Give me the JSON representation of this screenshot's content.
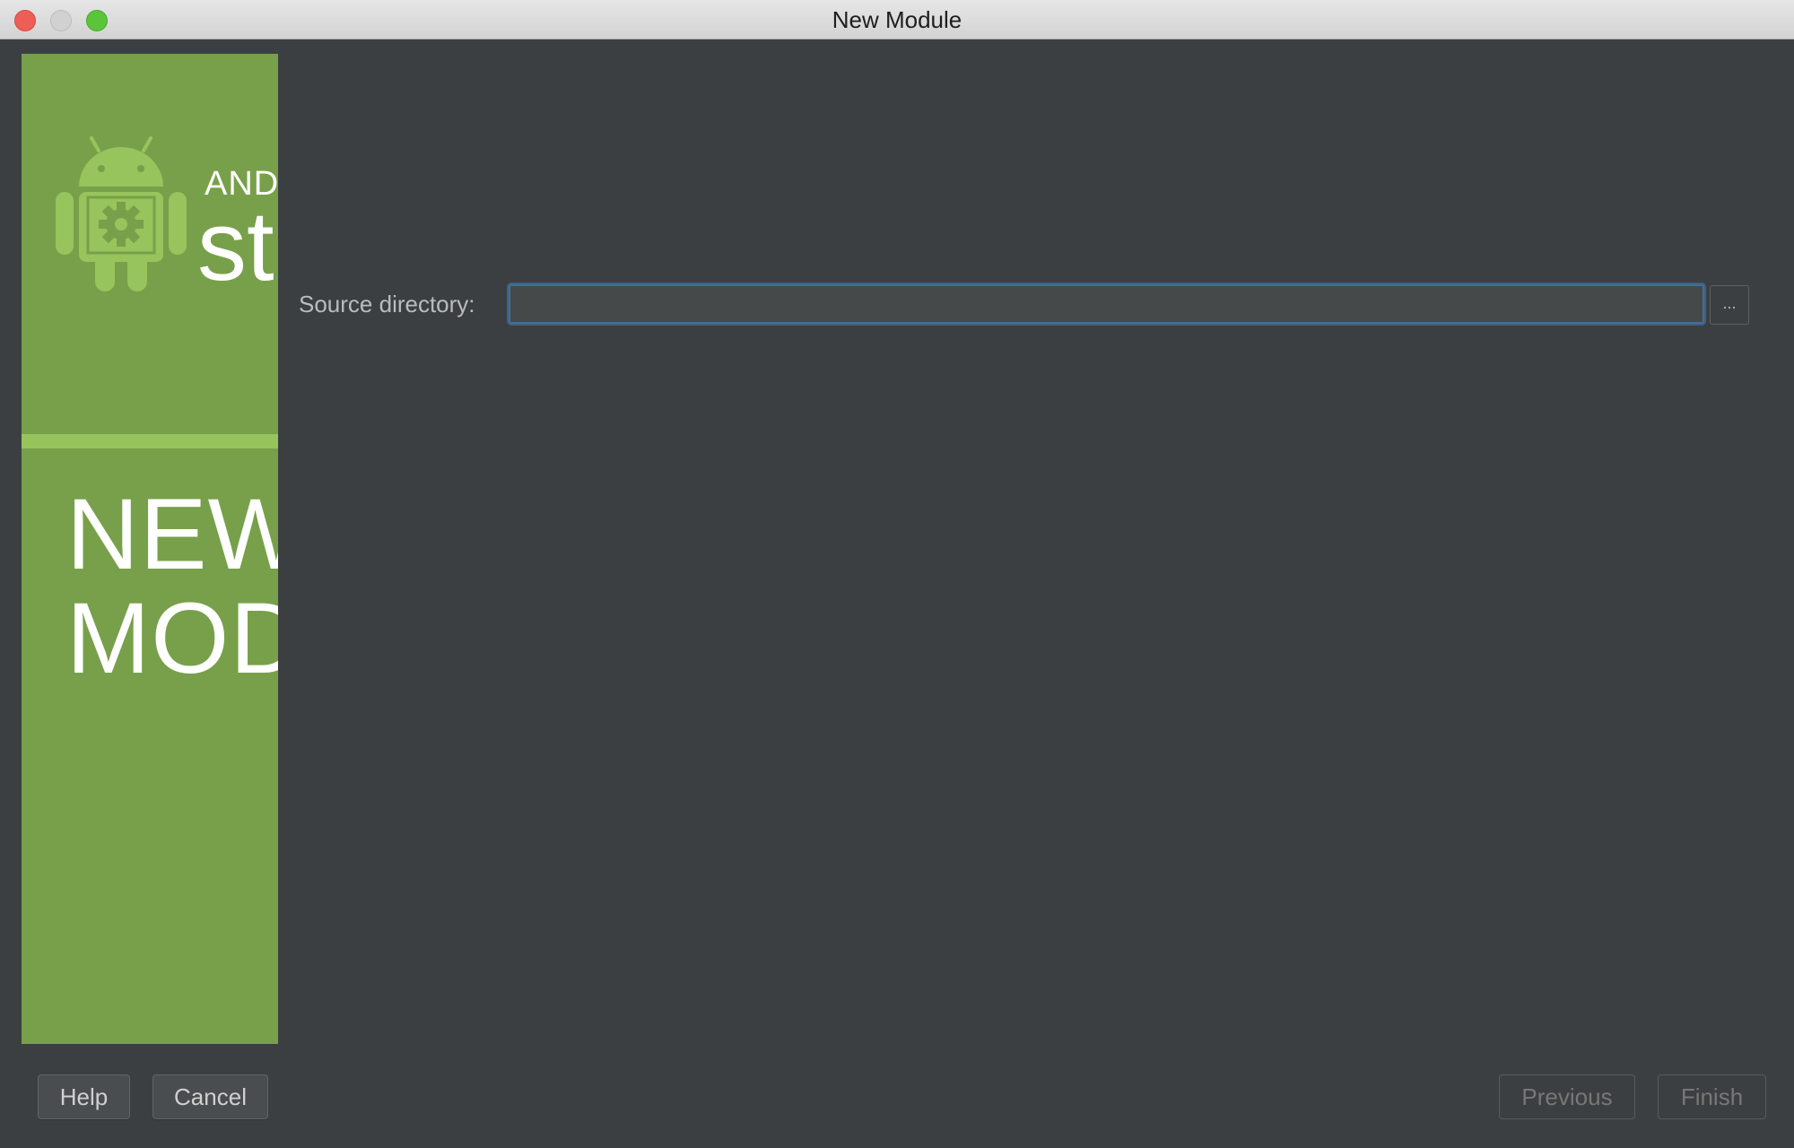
{
  "window": {
    "title": "New Module"
  },
  "banner": {
    "brand_small": "ANDR",
    "brand_big": "st",
    "title_line1": "NEW",
    "title_line2": "MOD",
    "colors": {
      "background": "#78a04a",
      "stripe": "#97c45c",
      "robot": "#97c45c"
    }
  },
  "form": {
    "source_directory_label": "Source directory:",
    "source_directory_value": "",
    "browse_label": "..."
  },
  "buttons": {
    "help": "Help",
    "cancel": "Cancel",
    "previous": "Previous",
    "finish": "Finish"
  },
  "icons": {
    "robot": "android-robot-icon"
  }
}
